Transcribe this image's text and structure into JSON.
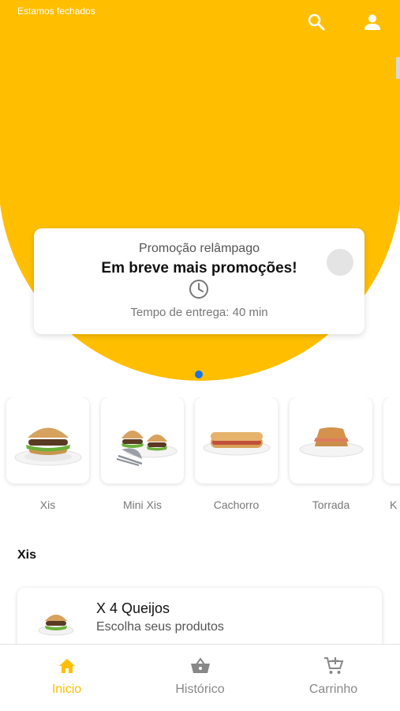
{
  "header": {
    "status_text": "Estamos fechados",
    "search_icon": "search-icon",
    "user_icon": "user-icon"
  },
  "colors": {
    "accent": "#FFBF00",
    "carousel_dot": "#1a73e8"
  },
  "promo": {
    "subtitle": "Promoção relâmpago",
    "title": "Em breve mais promoções!",
    "icon": "clock-icon",
    "delivery": "Tempo de entrega: 40 min"
  },
  "categories": [
    {
      "label": "Xis"
    },
    {
      "label": "Mini Xis"
    },
    {
      "label": "Cachorro"
    },
    {
      "label": "Torrada"
    },
    {
      "label": "K"
    }
  ],
  "section": {
    "title": "Xis"
  },
  "products": [
    {
      "name": "X 4 Queijos",
      "description": "Escolha seus produtos"
    }
  ],
  "bottom_nav": {
    "items": [
      {
        "label": "Inicio",
        "icon": "home-icon",
        "active": true
      },
      {
        "label": "Histórico",
        "icon": "basket-icon",
        "active": false
      },
      {
        "label": "Carrinho",
        "icon": "cart-add-icon",
        "active": false
      }
    ]
  }
}
